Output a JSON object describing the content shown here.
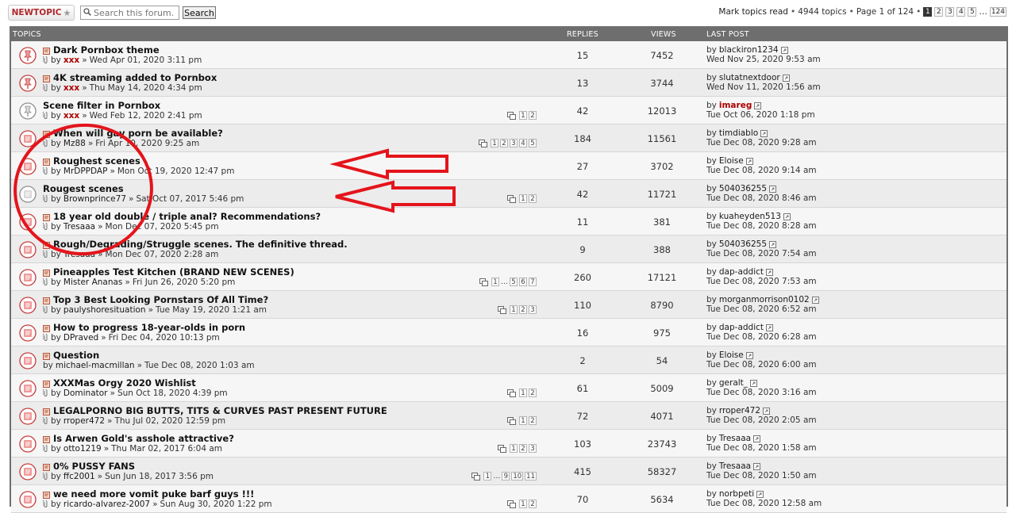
{
  "toolbar": {
    "new_topic_label": "NEWTOPIC",
    "new_topic_star": "★",
    "search_placeholder": "Search this forum...",
    "search_button": "Search",
    "mark_read": "Mark topics read",
    "sep": "•",
    "topic_count": "4944 topics",
    "page_info": "Page 1 of 124",
    "pages": [
      "1",
      "2",
      "3",
      "4",
      "5"
    ],
    "ellipsis": "…",
    "last_page": "124"
  },
  "headers": {
    "topics": "TOPICS",
    "replies": "REPLIES",
    "views": "VIEWS",
    "last_post": "LAST POST"
  },
  "labels": {
    "by": "by",
    "arrow": "»"
  },
  "icons": {
    "sticky": "sticky-topic-icon",
    "unread": "unread-topic-icon",
    "read": "read-topic-icon",
    "new_post": "new-post-icon",
    "attachment": "attachment-icon",
    "goto": "view-latest-post-icon",
    "multipage": "multipage-icon"
  },
  "colors": {
    "header_bg": "#6e6e6e",
    "new_topic": "#b0282b",
    "accent_red": "#aa0000",
    "annotation": "#e4141b"
  },
  "topics": [
    {
      "title": "Dark Pornbox theme",
      "author": "xxx",
      "author_red": true,
      "date": "Wed Apr 01, 2020 3:11 pm",
      "replies": "15",
      "views": "7452",
      "last_by": "blackiron1234",
      "last_red": false,
      "last_date": "Wed Nov 25, 2020 9:53 am",
      "pages": [],
      "icon": "sticky",
      "new": true,
      "clip": true
    },
    {
      "title": "4K streaming added to Pornbox",
      "author": "xxx",
      "author_red": true,
      "date": "Thu May 14, 2020 4:34 pm",
      "replies": "13",
      "views": "3744",
      "last_by": "slutatnextdoor",
      "last_red": false,
      "last_date": "Wed Nov 11, 2020 1:56 am",
      "pages": [],
      "icon": "sticky",
      "new": true,
      "clip": true
    },
    {
      "title": "Scene filter in Pornbox",
      "author": "xxx",
      "author_red": true,
      "date": "Wed Feb 12, 2020 2:41 pm",
      "replies": "42",
      "views": "12013",
      "last_by": "imareg",
      "last_red": true,
      "last_date": "Tue Oct 06, 2020 1:18 pm",
      "pages": [
        "1",
        "2"
      ],
      "icon": "sticky-read",
      "new": false,
      "clip": true
    },
    {
      "title": "When will gay porn be available?",
      "author": "Mz88",
      "author_red": false,
      "date": "Fri Apr 10, 2020 9:25 am",
      "replies": "184",
      "views": "11561",
      "last_by": "timdiablo",
      "last_red": false,
      "last_date": "Tue Dec 08, 2020 9:28 am",
      "pages": [
        "1",
        "2",
        "3",
        "4",
        "5"
      ],
      "icon": "unread",
      "new": true,
      "clip": true
    },
    {
      "title": "Roughest scenes",
      "author": "MrDPPDAP",
      "author_red": false,
      "date": "Mon Oct 19, 2020 12:47 pm",
      "replies": "27",
      "views": "3702",
      "last_by": "Eloise",
      "last_red": false,
      "last_date": "Tue Dec 08, 2020 9:14 am",
      "pages": [],
      "icon": "unread",
      "new": true,
      "clip": true
    },
    {
      "title": "Rougest scenes",
      "author": "Brownprince77",
      "author_red": false,
      "date": "Sat Oct 07, 2017 5:46 pm",
      "replies": "42",
      "views": "11721",
      "last_by": "504036255",
      "last_red": false,
      "last_date": "Tue Dec 08, 2020 8:46 am",
      "pages": [
        "1",
        "2"
      ],
      "icon": "read",
      "new": false,
      "clip": true
    },
    {
      "title": "18 year old double / triple anal? Recommendations?",
      "author": "Tresaaa",
      "author_red": false,
      "date": "Mon Dec 07, 2020 5:45 pm",
      "replies": "11",
      "views": "381",
      "last_by": "kuaheyden513",
      "last_red": false,
      "last_date": "Tue Dec 08, 2020 8:28 am",
      "pages": [],
      "icon": "unread",
      "new": true,
      "clip": true
    },
    {
      "title": "Rough/Degrading/Struggle scenes. The definitive thread.",
      "author": "Tresaaa",
      "author_red": false,
      "date": "Mon Dec 07, 2020 2:28 am",
      "replies": "9",
      "views": "388",
      "last_by": "504036255",
      "last_red": false,
      "last_date": "Tue Dec 08, 2020 7:54 am",
      "pages": [],
      "icon": "unread",
      "new": true,
      "clip": true
    },
    {
      "title": "Pineapples Test Kitchen (BRAND NEW SCENES)",
      "author": "Mister Ananas",
      "author_red": false,
      "date": "Fri Jun 26, 2020 5:20 pm",
      "replies": "260",
      "views": "17121",
      "last_by": "dap-addict",
      "last_red": false,
      "last_date": "Tue Dec 08, 2020 7:53 am",
      "pages": [
        "1",
        "…",
        "5",
        "6",
        "7"
      ],
      "icon": "unread",
      "new": true,
      "clip": true
    },
    {
      "title": "Top 3 Best Looking Pornstars Of All Time?",
      "author": "paulyshoresituation",
      "author_red": false,
      "date": "Tue May 19, 2020 1:21 am",
      "replies": "110",
      "views": "8790",
      "last_by": "morganmorrison0102",
      "last_red": false,
      "last_date": "Tue Dec 08, 2020 6:52 am",
      "pages": [
        "1",
        "2",
        "3"
      ],
      "icon": "unread",
      "new": true,
      "clip": true
    },
    {
      "title": "How to progress 18-year-olds in porn",
      "author": "DPraved",
      "author_red": false,
      "date": "Fri Dec 04, 2020 10:13 pm",
      "replies": "16",
      "views": "975",
      "last_by": "dap-addict",
      "last_red": false,
      "last_date": "Tue Dec 08, 2020 6:28 am",
      "pages": [],
      "icon": "unread",
      "new": true,
      "clip": true
    },
    {
      "title": "Question",
      "author": "michael-macmillan",
      "author_red": false,
      "date": "Tue Dec 08, 2020 1:03 am",
      "replies": "2",
      "views": "54",
      "last_by": "Eloise",
      "last_red": false,
      "last_date": "Tue Dec 08, 2020 6:00 am",
      "pages": [],
      "icon": "unread",
      "new": true,
      "clip": false
    },
    {
      "title": "XXXMas Orgy 2020 Wishlist",
      "author": "Dominator",
      "author_red": false,
      "date": "Sun Oct 18, 2020 4:39 pm",
      "replies": "61",
      "views": "5009",
      "last_by": "geralt_",
      "last_red": false,
      "last_date": "Tue Dec 08, 2020 3:16 am",
      "pages": [
        "1",
        "2"
      ],
      "icon": "unread",
      "new": true,
      "clip": true
    },
    {
      "title": "LEGALPORNO BIG BUTTS, TITS & CURVES PAST PRESENT FUTURE",
      "author": "rroper472",
      "author_red": false,
      "date": "Thu Jul 02, 2020 12:59 pm",
      "replies": "72",
      "views": "4071",
      "last_by": "rroper472",
      "last_red": false,
      "last_date": "Tue Dec 08, 2020 2:05 am",
      "pages": [
        "1",
        "2"
      ],
      "icon": "unread",
      "new": true,
      "clip": true
    },
    {
      "title": "Is Arwen Gold's asshole attractive?",
      "author": "otto1219",
      "author_red": false,
      "date": "Thu Mar 02, 2017 6:04 am",
      "replies": "103",
      "views": "23743",
      "last_by": "Tresaaa",
      "last_red": false,
      "last_date": "Tue Dec 08, 2020 1:58 am",
      "pages": [
        "1",
        "2",
        "3"
      ],
      "icon": "unread",
      "new": true,
      "clip": true
    },
    {
      "title": "0% PUSSY FANS",
      "author": "ffc2001",
      "author_red": false,
      "date": "Sun Jun 18, 2017 3:56 pm",
      "replies": "415",
      "views": "58327",
      "last_by": "Tresaaa",
      "last_red": false,
      "last_date": "Tue Dec 08, 2020 1:50 am",
      "pages": [
        "1",
        "…",
        "9",
        "10",
        "11"
      ],
      "icon": "unread",
      "new": true,
      "clip": true
    },
    {
      "title": "we need more vomit puke barf guys !!!",
      "author": "ricardo-alvarez-2007",
      "author_red": false,
      "date": "Sun Aug 30, 2020 1:22 pm",
      "replies": "70",
      "views": "5634",
      "last_by": "norbpeti",
      "last_red": false,
      "last_date": "Tue Dec 08, 2020 12:58 am",
      "pages": [
        "1",
        "2"
      ],
      "icon": "unread",
      "new": true,
      "clip": true
    }
  ]
}
